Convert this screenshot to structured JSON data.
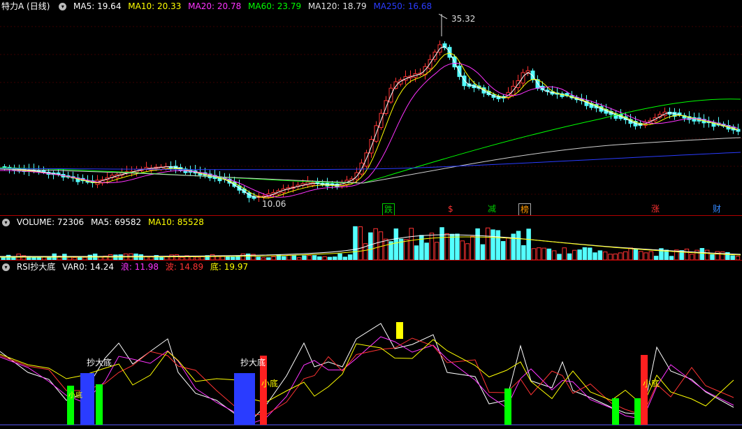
{
  "main": {
    "title": "特力A (日线)",
    "ma": [
      {
        "label": "MA5: 19.64",
        "color": "#ffffff"
      },
      {
        "label": "MA10: 20.33",
        "color": "#ffff00"
      },
      {
        "label": "MA20: 20.78",
        "color": "#ff33ff"
      },
      {
        "label": "MA60: 23.79",
        "color": "#00ff00"
      },
      {
        "label": "MA120: 18.79",
        "color": "#e0e0e0"
      },
      {
        "label": "MA250: 16.68",
        "color": "#2a3cff"
      }
    ],
    "high_label": "35.32",
    "low_label": "10.06",
    "events": [
      "跌",
      "$",
      "减",
      "榜",
      "涨",
      "财"
    ]
  },
  "volume": {
    "title": "VOLUME: 72306",
    "ma5": "MA5: 69582",
    "ma10": "MA10: 85528"
  },
  "indicator": {
    "title": "RSI抄大底",
    "var0": "VAR0: 14.24",
    "lang": "浪: 11.98",
    "bo": "波: 14.89",
    "di": "底: 19.97",
    "labels": [
      "抄大底",
      "抄大底",
      "小底",
      "小底",
      "小底"
    ]
  },
  "colors": {
    "up": "#ff3232",
    "down": "#54ffff",
    "bg": "#000000",
    "sep": "#b00000"
  }
}
